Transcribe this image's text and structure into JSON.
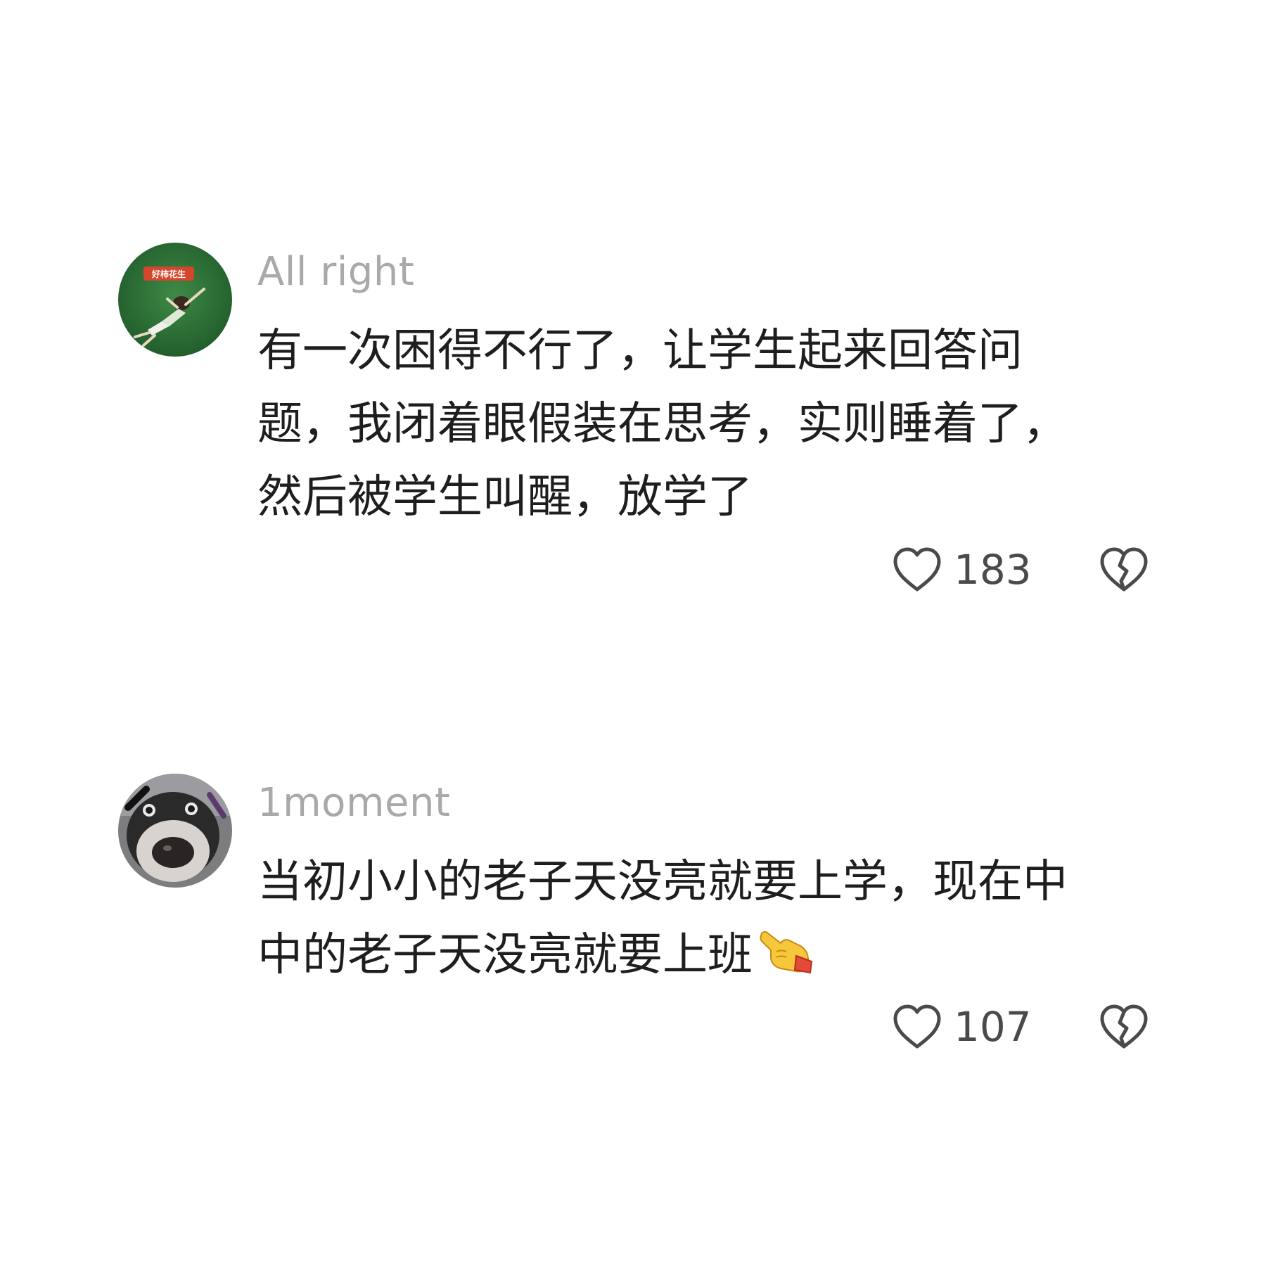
{
  "comments": [
    {
      "username": "All right",
      "avatar": "girl-lying-on-grass",
      "avatar_label": "好柿花生",
      "lines": [
        "有一次困得不行了，让学生起来回答问",
        "题，我闭着眼假装在思考，实则睡着了，",
        "然后被学生叫醒，放学了"
      ],
      "likes": "183"
    },
    {
      "username": "1moment",
      "avatar": "dog-nose-closeup",
      "lines": [
        "当初小小的老子天没亮就要上学，现在中",
        "中的老子天没亮就要上班"
      ],
      "trailing_emoji": "backhand-pointing-left-emoji",
      "likes": "107"
    }
  ],
  "icons": {
    "like": "heart-outline-icon",
    "dislike": "broken-heart-outline-icon"
  },
  "colors": {
    "background": "#ffffff",
    "username": "#a9a9a9",
    "text": "#1e1e1e",
    "icon": "#4a4a4a"
  }
}
